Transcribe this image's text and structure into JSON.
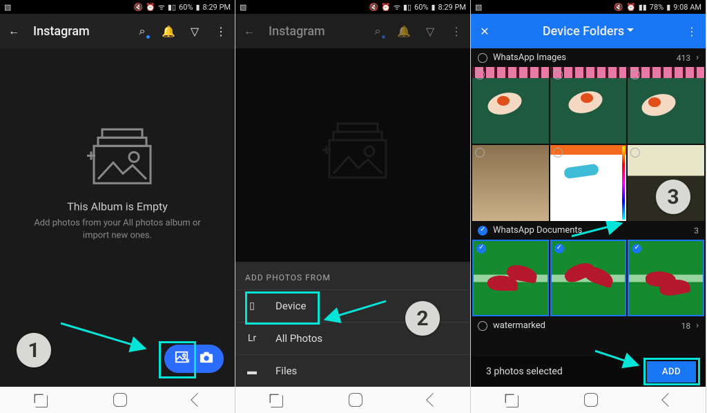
{
  "statusbar": {
    "battery1": "60%",
    "time1": "8:29 PM",
    "battery3": "78%",
    "time3": "9:08 AM"
  },
  "screen1": {
    "title": "Instagram",
    "empty_title": "This Album is Empty",
    "empty_sub": "Add photos from your All photos album or import new ones."
  },
  "screen2": {
    "title": "Instagram",
    "sheet_title": "ADD PHOTOS FROM",
    "rows": [
      {
        "label": "Device"
      },
      {
        "label": "All Photos"
      },
      {
        "label": "Files"
      }
    ]
  },
  "screen3": {
    "title": "Device Folders",
    "folders": [
      {
        "name": "WhatsApp Images",
        "count": "413",
        "checked": false
      },
      {
        "name": "WhatsApp Documents",
        "count": "3",
        "checked": true
      },
      {
        "name": "watermarked",
        "count": "18",
        "checked": false
      }
    ],
    "toast": "3 photos selected",
    "add_label": "ADD"
  },
  "annotations": {
    "step1": "1",
    "step2": "2",
    "step3": "3"
  }
}
